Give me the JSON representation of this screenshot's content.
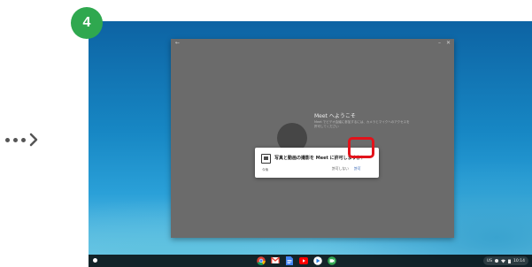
{
  "step": {
    "number": "4"
  },
  "window": {
    "back_icon": "←",
    "minimize_icon": "–",
    "close_icon": "✕"
  },
  "welcome": {
    "title": "Meet へようこそ",
    "description": "Meet でビデオ会議に参加するには、カメラとマイクへのアクセスを許可してください",
    "grant_button": "許可"
  },
  "dialog": {
    "question": "写真と動画の撮影を Meet に許可しますか？",
    "origin": "今後",
    "deny_label": "許可しない",
    "allow_label": "許可"
  },
  "shelf": {
    "apps": [
      "chrome-icon",
      "gmail-icon",
      "docs-icon",
      "youtube-icon",
      "play-store-icon",
      "meet-icon"
    ]
  },
  "tray": {
    "locale": "US",
    "time": "10:14"
  },
  "colors": {
    "step_badge": "#2fa84f",
    "highlight": "#e2131b"
  }
}
